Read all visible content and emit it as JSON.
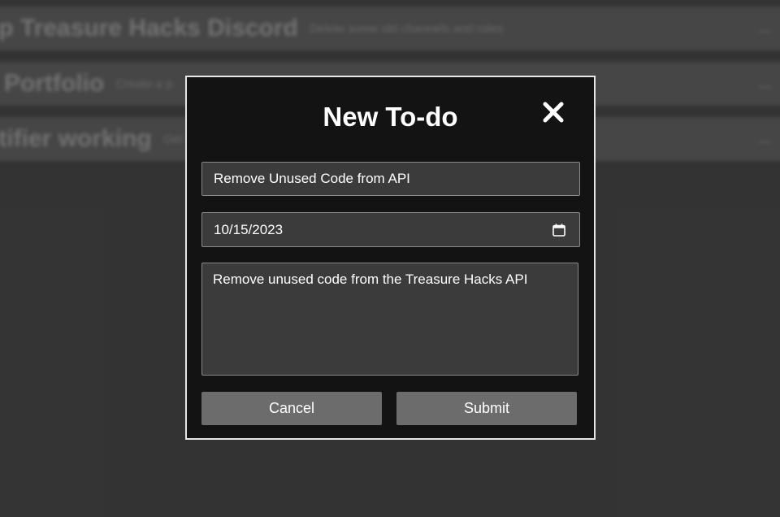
{
  "background": {
    "todos": [
      {
        "title": "up Treasure Hacks Discord",
        "description": "Delete some old channels and roles",
        "more": "..."
      },
      {
        "title": "e Portfolio",
        "description": "Create a p",
        "more": "..."
      },
      {
        "title": "otifier working",
        "description": "Get",
        "more": "..."
      }
    ]
  },
  "modal": {
    "title": "New To-do",
    "close_icon": "close-icon",
    "fields": {
      "title_value": "Remove Unused Code from API",
      "date_value": "10/15/2023",
      "description_value": "Remove unused code from the Treasure Hacks API"
    },
    "buttons": {
      "cancel_label": "Cancel",
      "submit_label": "Submit"
    }
  },
  "colors": {
    "modal_bg": "#131313",
    "field_bg": "#3b3b3b",
    "button_bg": "#6c6c6c",
    "page_bg": "#3a3a3a"
  }
}
